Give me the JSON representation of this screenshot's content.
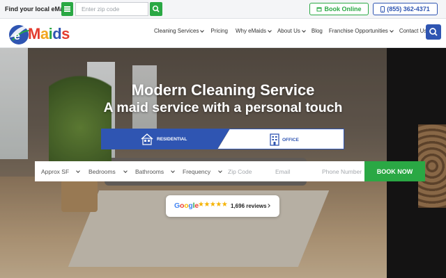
{
  "topbar": {
    "find_label": "Find your local eMaids",
    "zip_placeholder": "Enter zip code",
    "book_online_label": "Book Online",
    "phone_label": "(855) 362-4371"
  },
  "brand": {
    "logo_letter": "e",
    "logo_text": "Maids",
    "accent_blue": "#2f55b2",
    "accent_green": "#2aa844"
  },
  "nav": {
    "items": [
      {
        "label": "Cleaning Services",
        "has_dropdown": true
      },
      {
        "label": "Pricing",
        "has_dropdown": false
      },
      {
        "label": "Why eMaids",
        "has_dropdown": true
      },
      {
        "label": "About Us",
        "has_dropdown": true
      },
      {
        "label": "Blog",
        "has_dropdown": false
      },
      {
        "label": "Franchise Opportunities",
        "has_dropdown": true
      },
      {
        "label": "Contact Us",
        "has_dropdown": false
      }
    ]
  },
  "hero": {
    "title": "Modern Cleaning Service",
    "subtitle": "A maid service with a personal touch",
    "tabs": [
      {
        "label": "RESIDENTIAL",
        "icon": "house-icon",
        "active": true
      },
      {
        "label": "OFFICE",
        "icon": "office-building-icon",
        "active": false
      }
    ]
  },
  "booking_form": {
    "approx_sf": "Approx SF",
    "bedrooms": "Bedrooms",
    "bathrooms": "Bathrooms",
    "frequency": "Frequency",
    "zip_placeholder": "Zip Code",
    "email_placeholder": "Email",
    "phone_placeholder": "Phone Number",
    "submit_label": "BOOK NOW"
  },
  "reviews": {
    "provider": "Google",
    "stars": "★★★★★",
    "rating": 5,
    "count_label": "1,696 reviews"
  }
}
